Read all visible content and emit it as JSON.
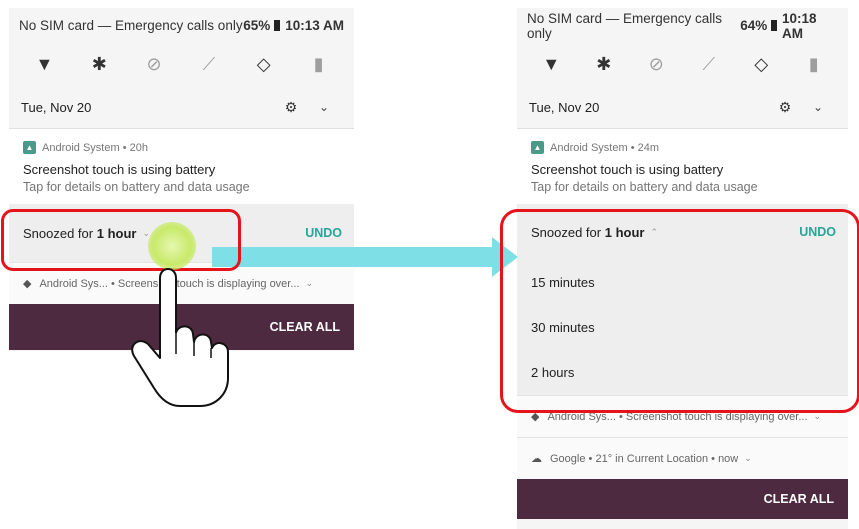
{
  "left_panel": {
    "status": {
      "carrier": "No SIM card — Emergency calls only",
      "battery": "65%",
      "time": "10:13 AM"
    },
    "date": "Tue, Nov 20",
    "notification": {
      "app": "Android System",
      "age": "20h",
      "title": "Screenshot touch is using battery",
      "text": "Tap for details on battery and data usage"
    },
    "snooze": {
      "prefix": "Snoozed for",
      "duration": "1 hour",
      "undo": "UNDO"
    },
    "mini_notification": {
      "app": "Android Sys...",
      "text": "Screenshot touch is displaying over..."
    },
    "clear_all": "CLEAR ALL"
  },
  "right_panel": {
    "status": {
      "carrier": "No SIM card — Emergency calls only",
      "battery": "64%",
      "time": "10:18 AM"
    },
    "date": "Tue, Nov 20",
    "notification": {
      "app": "Android System",
      "age": "24m",
      "title": "Screenshot touch is using battery",
      "text": "Tap for details on battery and data usage"
    },
    "snooze": {
      "prefix": "Snoozed for",
      "duration": "1 hour",
      "undo": "UNDO"
    },
    "snooze_options": [
      "15 minutes",
      "30 minutes",
      "2 hours"
    ],
    "mini_notification": {
      "app": "Android Sys...",
      "text": "Screenshot touch is displaying over..."
    },
    "google_notification": {
      "app": "Google",
      "text": "21° in Current Location",
      "age": "now"
    },
    "clear_all": "CLEAR ALL"
  },
  "icons": [
    "wifi-icon",
    "bluetooth-icon",
    "dnd-icon",
    "flashlight-icon",
    "auto-rotate-icon",
    "battery-saver-icon",
    "settings-icon",
    "expand-icon",
    "hand-pointer-icon",
    "arrow-icon"
  ],
  "colors": {
    "highlight": "#e5141c",
    "arrow": "#7fdfe6",
    "accent": "#26a69a",
    "clear_bar": "#4e2a40"
  }
}
